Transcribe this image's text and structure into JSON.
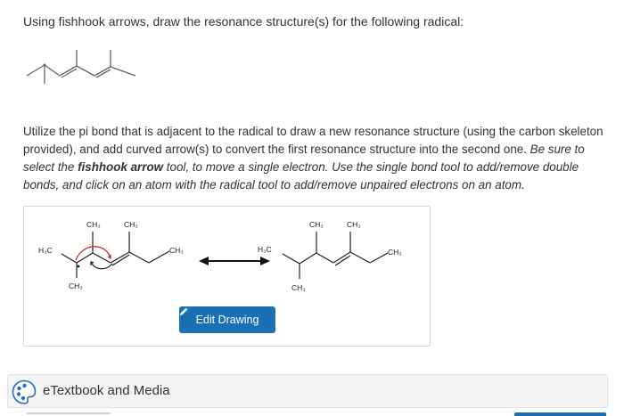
{
  "question": {
    "text": "Using fishhook arrows, draw the resonance structure(s) for the following radical:"
  },
  "instructions": {
    "plain": "Utilize the pi bond that is adjacent to the radical to draw a new resonance structure (using the carbon skeleton provided), and add curved arrow(s) to convert the first resonance structure into the second one.",
    "italic_start": "Be sure to select the",
    "bold_tool": "fishhook arrow",
    "italic_end": "tool, to move a single electron. Use the single bond tool to add/remove double bonds, and click on an atom with the radical tool to add/remove unpaired electrons on an atom."
  },
  "drawing": {
    "left": {
      "label_h3c": "H₃C",
      "label_ch3_top1": "CH₃",
      "label_ch3_top2": "CH₃",
      "label_ch3_right": "CH₃",
      "label_ch3_bottom": "CH₃"
    },
    "right": {
      "label_h3c": "H₃C",
      "label_ch3_top1": "CH₃",
      "label_ch3_top2": "CH₃",
      "label_ch3_right": "CH₃",
      "label_ch3_bottom": "CH₃"
    },
    "edit_button_label": "Edit Drawing"
  },
  "etextbook": {
    "label": "eTextbook and Media"
  },
  "colors": {
    "button": "#1a6fb5",
    "text": "#333333",
    "arrow_red": "#cc2222",
    "etextbook_icon": "#2a6fbd"
  },
  "icons": [
    "pencil-icon",
    "etextbook-media-icon",
    "double-headed-resonance-arrow"
  ]
}
